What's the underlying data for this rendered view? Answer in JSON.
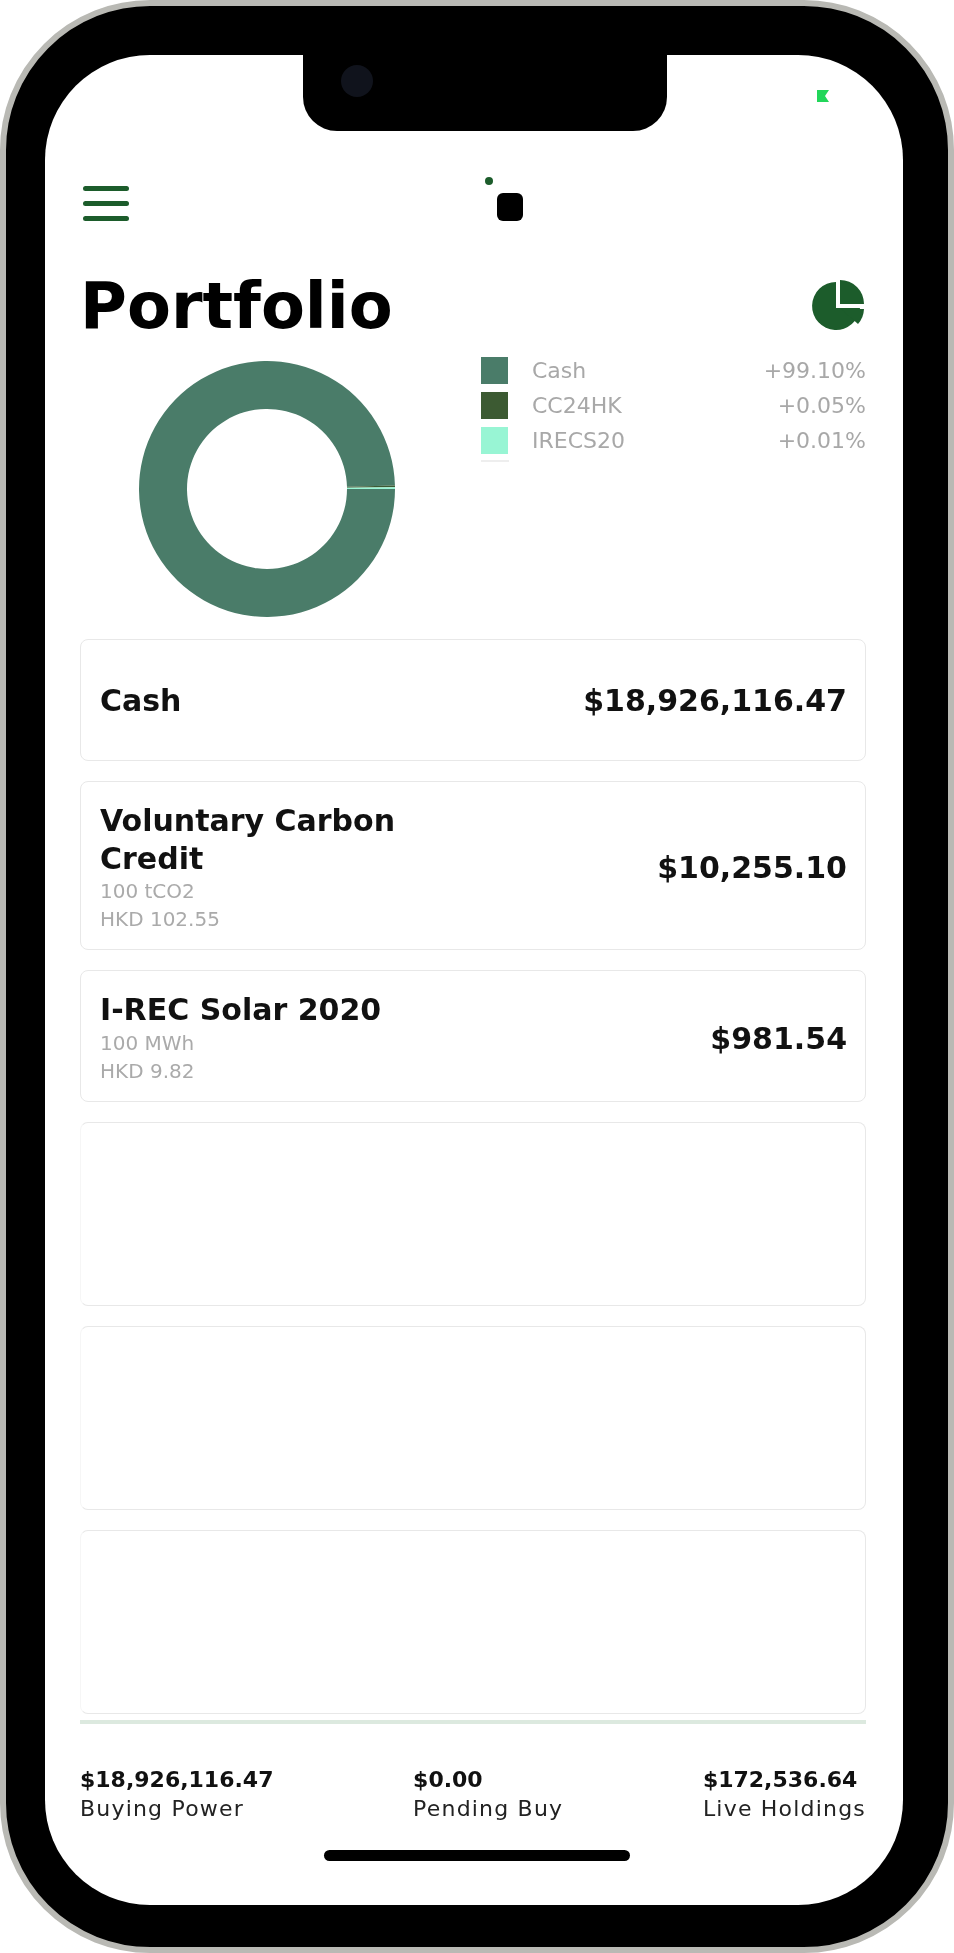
{
  "header": {
    "title": "Portfolio"
  },
  "chart_data": {
    "type": "donut",
    "categories": [
      "Cash",
      "CC24HK",
      "IRECS20"
    ],
    "values": [
      99.1,
      0.05,
      0.01
    ]
  },
  "legend": [
    {
      "value": "+99.10%",
      "color": "#4a7c69"
    },
    {
      "value": "+0.05%",
      "color": "#3c5a32"
    },
    {
      "value": "+0.01%",
      "color": "#98f5d4"
    }
  ],
  "holdings": [
    {
      "kind": "cash",
      "name": "Cash",
      "amount": "$18,926,116.47"
    },
    {
      "kind": "asset",
      "name": "Voluntary Carbon Credit",
      "quantity": "100 tCO2",
      "price": "HKD 102.55",
      "amount": "$10,255.10"
    },
    {
      "kind": "asset",
      "name": "I-REC Solar 2020",
      "quantity": "100 MWh",
      "price": "HKD 9.82",
      "amount": "$981.54"
    },
    {
      "kind": "empty"
    },
    {
      "kind": "empty"
    },
    {
      "kind": "empty"
    }
  ],
  "summary": [
    {
      "amount": "$18,926,116.47",
      "label": "Buying Power"
    },
    {
      "amount": "$0.00",
      "label": "Pending Buy"
    },
    {
      "amount": "$172,536.64",
      "label": "Live Holdings"
    }
  ]
}
